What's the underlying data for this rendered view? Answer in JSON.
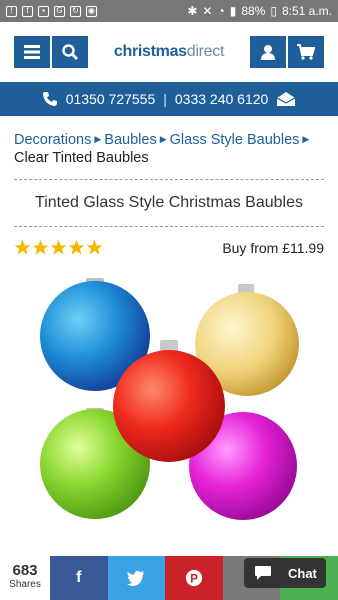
{
  "status": {
    "time": "8:51 a.m.",
    "battery": "88%"
  },
  "brand": {
    "part1": "christmas",
    "part2": "direct"
  },
  "phones": [
    "01350 727555",
    "0333 240 6120"
  ],
  "breadcrumb": {
    "items": [
      "Decorations",
      "Baubles",
      "Glass Style Baubles"
    ],
    "current": "Clear Tinted Baubles"
  },
  "product": {
    "title": "Tinted Glass Style Christmas Baubles",
    "price": "Buy from £11.99",
    "rating": 5
  },
  "share": {
    "count": "683",
    "label": "Shares"
  },
  "chat": {
    "label": "Chat"
  },
  "colors": {
    "brand": "#1e5f9a",
    "facebook": "#3b5998",
    "twitter": "#3aa3e3",
    "pinterest": "#c92228",
    "email": "#7a7a7a",
    "whatsapp": "#4caf50"
  }
}
